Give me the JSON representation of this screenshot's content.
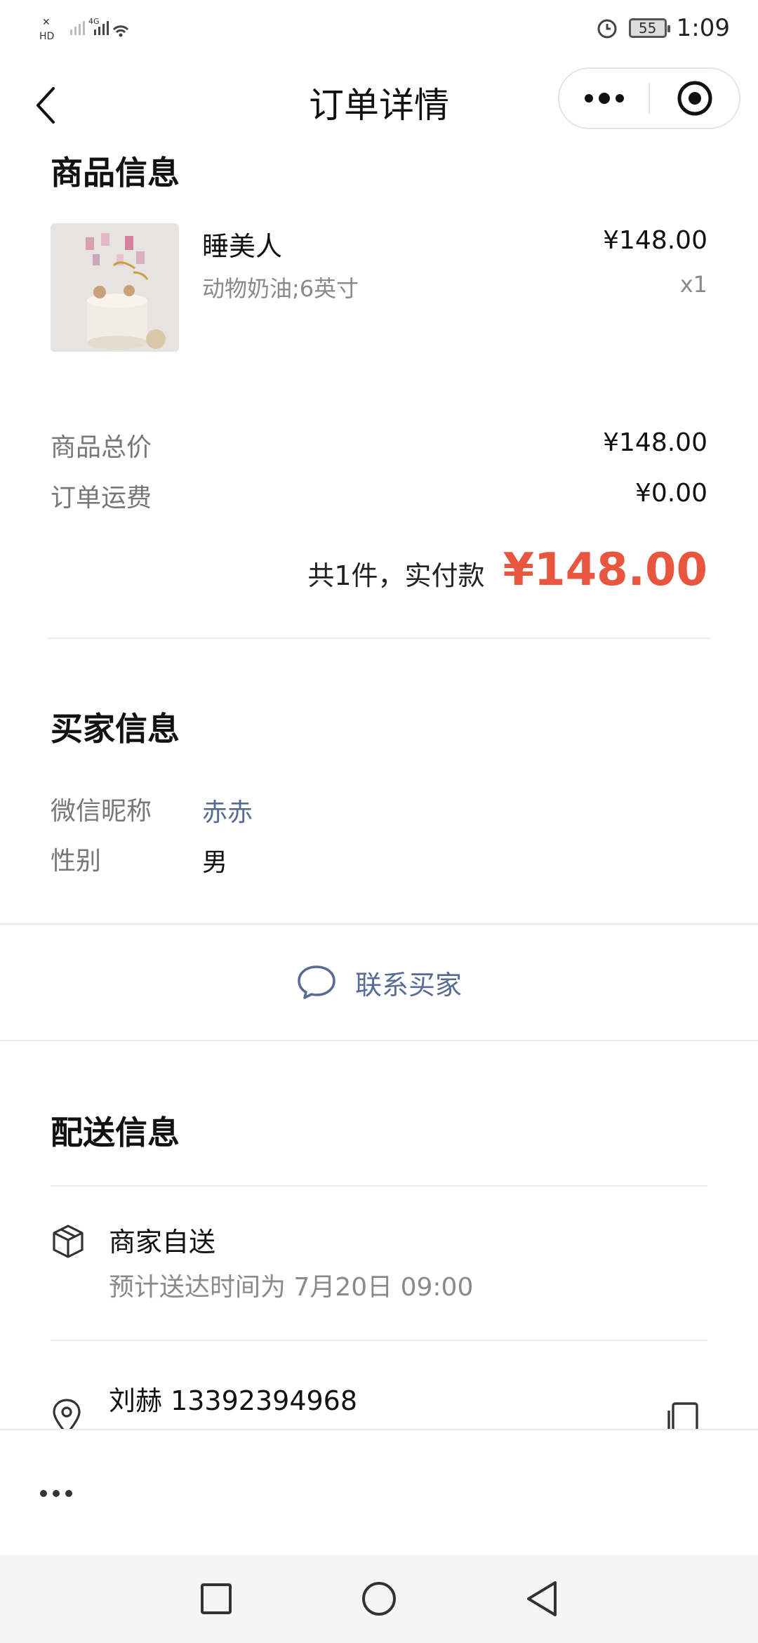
{
  "status": {
    "left_indicators": [
      "HD",
      "4G"
    ],
    "battery": "55",
    "time": "1:09"
  },
  "titlebar": {
    "title": "订单详情"
  },
  "product_section": {
    "title": "商品信息",
    "item": {
      "name": "睡美人",
      "spec": "动物奶油;6英寸",
      "price": "¥148.00",
      "quantity": "x1"
    },
    "summary": {
      "goods_total_label": "商品总价",
      "goods_total_value": "¥148.00",
      "shipping_label": "订单运费",
      "shipping_value": "¥0.00",
      "total_text": "共1件，实付款",
      "total_amount": "¥148.00"
    }
  },
  "buyer_section": {
    "title": "买家信息",
    "nickname_label": "微信昵称",
    "nickname_value": "赤赤",
    "gender_label": "性别",
    "gender_value": "男",
    "contact_label": "联系买家"
  },
  "delivery_section": {
    "title": "配送信息",
    "method": "商家自送",
    "eta": "预计送达时间为 7月20日 09:00",
    "recipient": "刘赫 13392394968"
  },
  "colors": {
    "accent_price": "#e8563f",
    "link": "#576b95"
  }
}
